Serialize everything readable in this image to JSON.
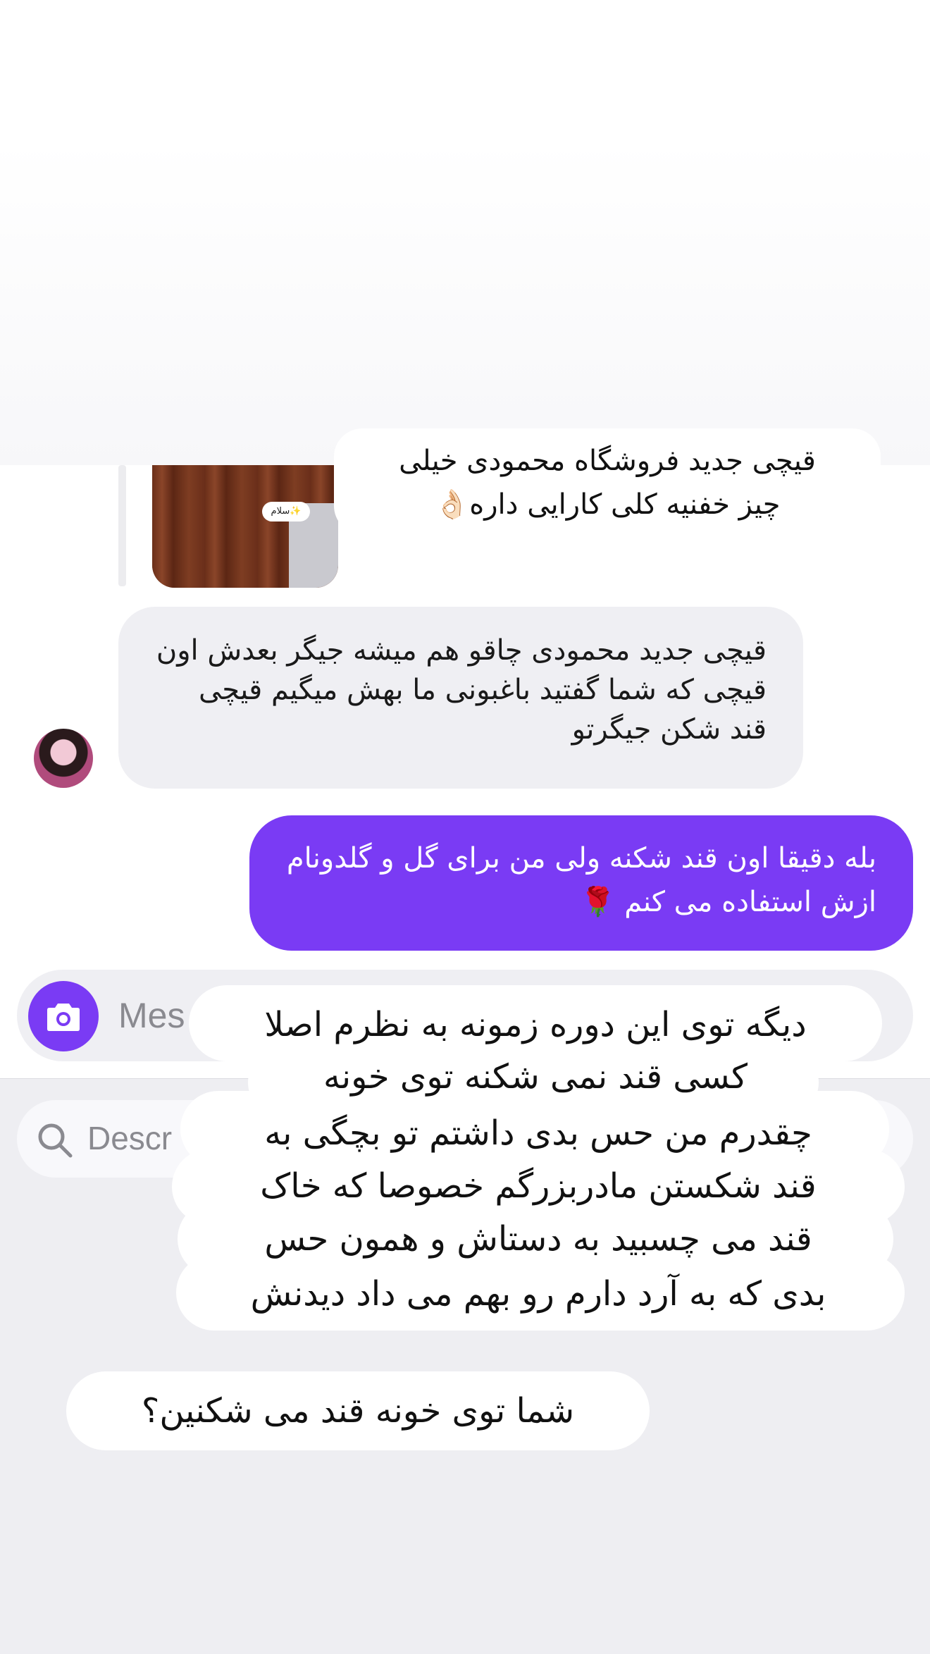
{
  "shared_post": {
    "sticker_text": "سلام✨",
    "caption_lines": [
      "قیچی جدید فروشگاه محمودی خیلی",
      "چیز خفنیه کلی کارایی داره👌🏻"
    ]
  },
  "messages": {
    "incoming": "قیچی جدید محمودی چاقو هم میشه جیگر بعدش اون قیچی که شما گفتید باغبونی ما بهش میگیم قیچی قند شکن جیگرتو",
    "outgoing": "بله دقیقا اون قند شکنه ولی من برای گل و گلدونام ازش استفاده می کنم 🌹"
  },
  "composer": {
    "placeholder": "Mes",
    "camera_icon": "camera-icon"
  },
  "sticker_search": {
    "placeholder": "Descr",
    "search_icon": "search-icon"
  },
  "story_text": {
    "block1": [
      "دیگه توی این دوره زمونه به نظرم اصلا",
      "کسی قند نمی شکنه توی خونه",
      "چقدرم من حس بدی داشتم تو بچگی به",
      "قند شکستن مادربزرگم خصوصا که خاک",
      "قند می چسبید به دستاش و همون حس",
      "بدی که به آرد دارم رو بهم می داد دیدنش"
    ],
    "block2": "شما توی خونه قند می شکنین؟"
  },
  "colors": {
    "accent": "#7a3bf4",
    "incoming_bubble": "#efeff3",
    "sheet_bg": "#eeeef2"
  }
}
